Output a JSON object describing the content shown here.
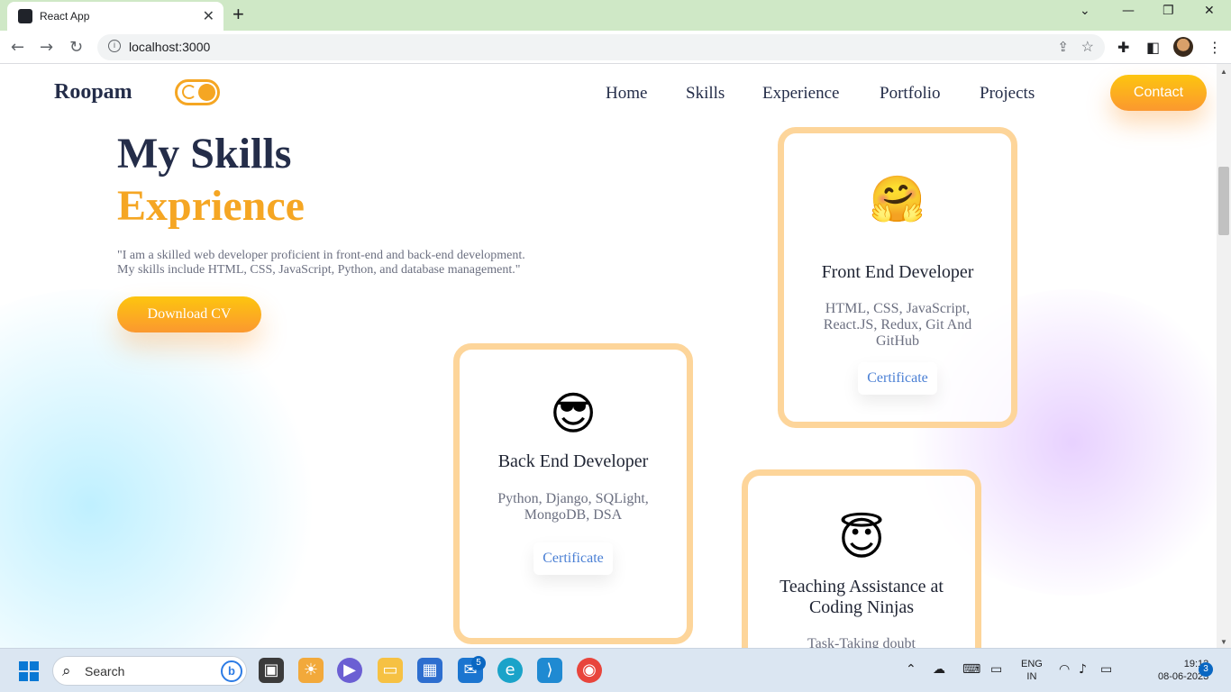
{
  "browser": {
    "tab_title": "React App",
    "url": "localhost:3000"
  },
  "site": {
    "brand": "Roopam",
    "nav": [
      "Home",
      "Skills",
      "Experience",
      "Portfolio",
      "Projects"
    ],
    "contact_label": "Contact",
    "heading_line1": "My Skills",
    "heading_line2": "Exprience",
    "intro_line1": "\"I am a skilled web developer proficient in front-end and back-end development.",
    "intro_line2": "My skills include HTML, CSS, JavaScript, Python, and database management.\"",
    "cv_label": "Download CV",
    "accent_color": "#f5a623",
    "cards": [
      {
        "emoji": "🤗",
        "title": "Front End Developer",
        "desc": "HTML, CSS, JavaScript, React.JS, Redux, Git And GitHub",
        "button": "Certificate"
      },
      {
        "emoji": "😎",
        "title": "Back End Developer",
        "desc": "Python, Django, SQLight, MongoDB, DSA",
        "button": "Certificate"
      },
      {
        "emoji": "😇",
        "title": "Teaching Assistance at Coding Ninjas",
        "desc": "Task-Taking doubt"
      }
    ]
  },
  "taskbar": {
    "search_placeholder": "Search",
    "mail_badge": "5",
    "lang_line1": "ENG",
    "lang_line2": "IN",
    "time": "19:13",
    "date": "08-06-2023",
    "notifications": "3"
  }
}
